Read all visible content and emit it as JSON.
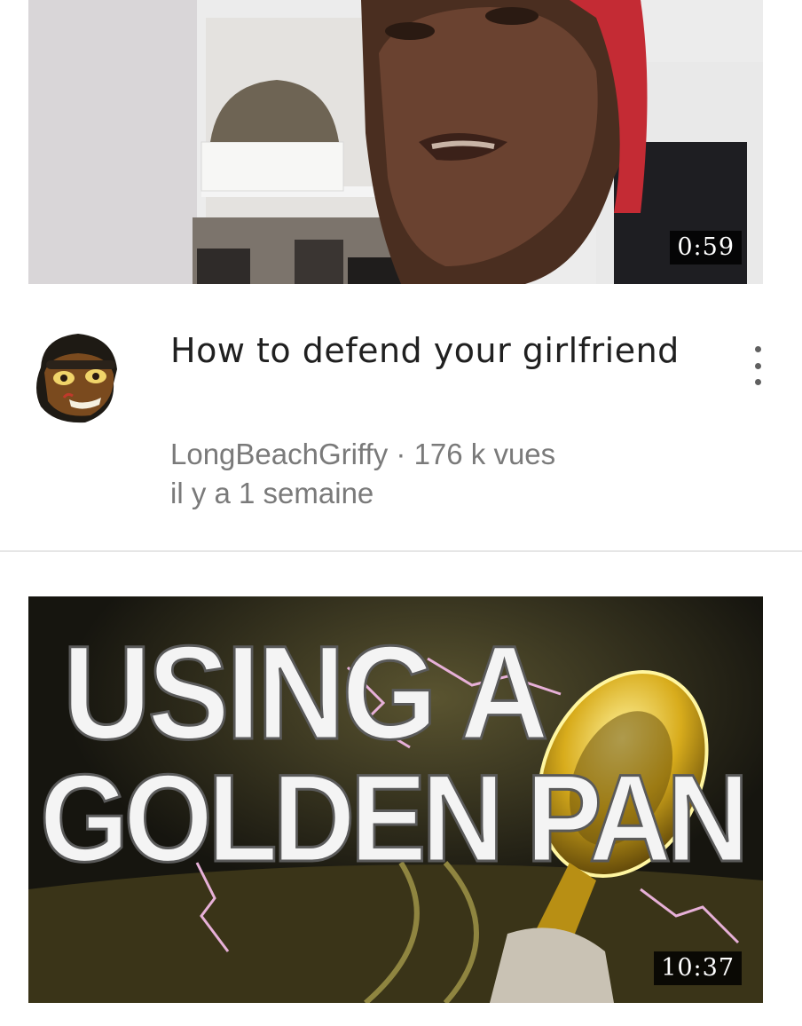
{
  "videos": [
    {
      "duration": "0:59",
      "title": "How to defend your girlfriend",
      "channel": "LongBeachGriffy",
      "separator": "·",
      "views": "176 k vues",
      "age": "il y a 1 semaine"
    },
    {
      "duration": "10:37",
      "thumb_text_line1": "USING A",
      "thumb_text_line2": "GOLDEN PAN"
    }
  ],
  "icons": {
    "menu": "more-vert-icon",
    "avatar": "channel-avatar"
  },
  "colors": {
    "title": "#202020",
    "subtitle": "#7a7a7a",
    "divider": "#e6e6e6",
    "gold": "#e6c21c"
  }
}
